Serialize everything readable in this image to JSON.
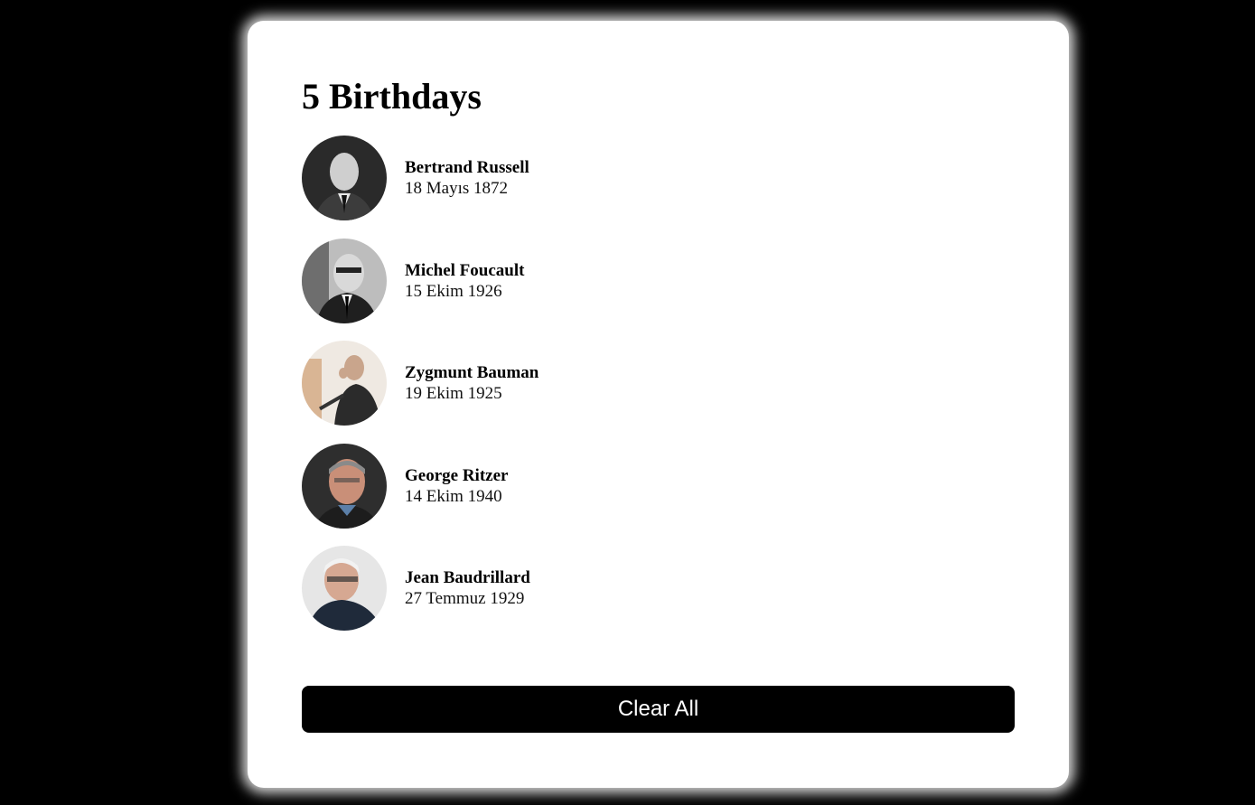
{
  "header": {
    "count": "5",
    "title": "Birthdays"
  },
  "people": [
    {
      "name": "Bertrand Russell",
      "date": "18 Mayıs 1872"
    },
    {
      "name": "Michel Foucault",
      "date": "15 Ekim 1926"
    },
    {
      "name": "Zygmunt Bauman",
      "date": "19 Ekim 1925"
    },
    {
      "name": "George Ritzer",
      "date": "14 Ekim 1940"
    },
    {
      "name": "Jean Baudrillard",
      "date": "27 Temmuz 1929"
    }
  ],
  "actions": {
    "clear_label": "Clear All"
  }
}
